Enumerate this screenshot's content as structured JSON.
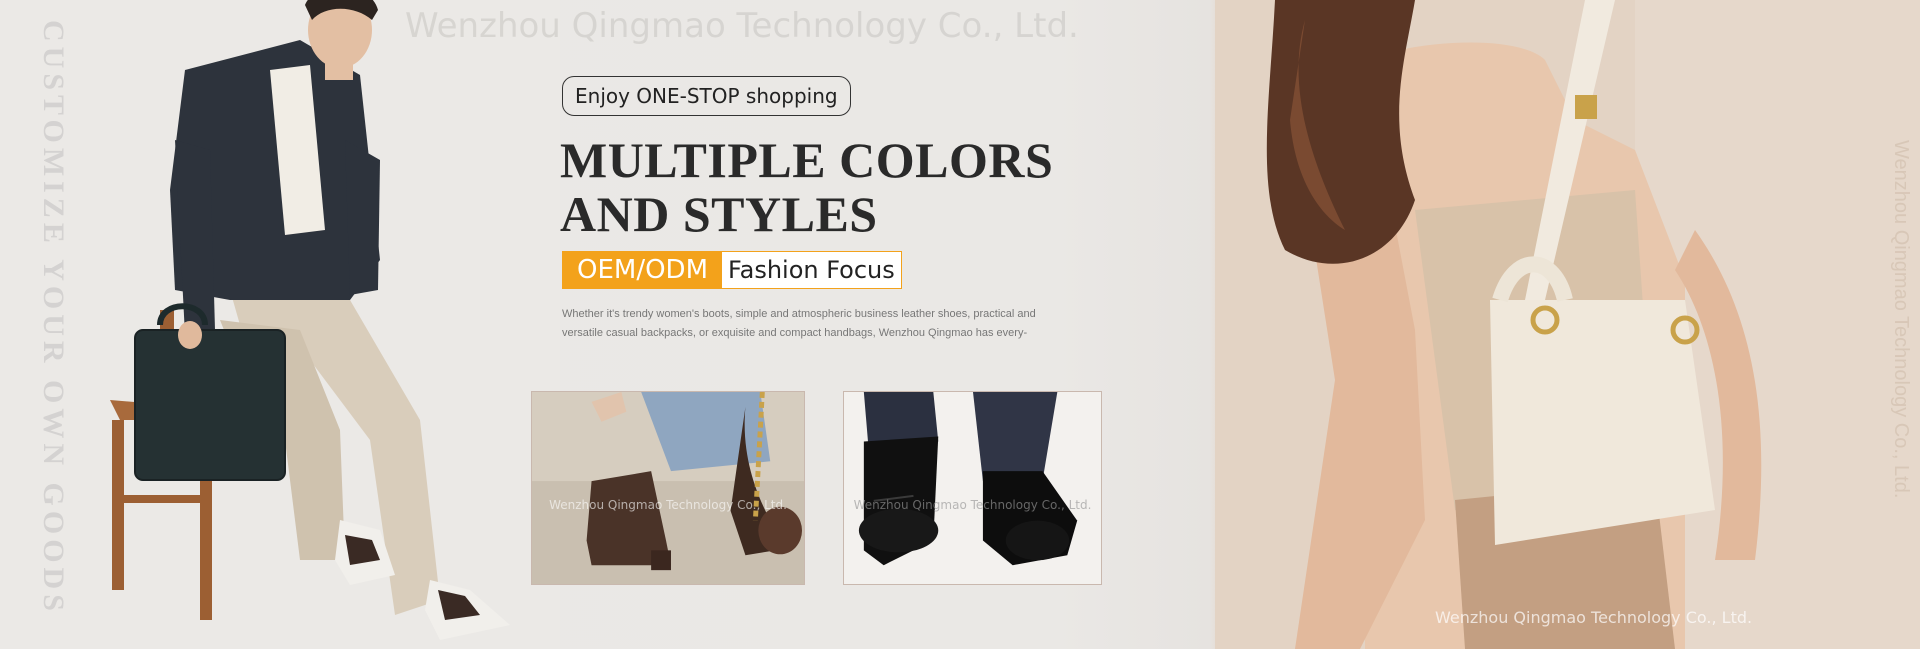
{
  "brand": {
    "watermark_top": "Wenzhou Qingmao Technology Co., Ltd.",
    "watermark_bottom": "Wenzhou Qingmao Technology Co., Ltd.",
    "vertical_left": "CUSTOMIZE YOUR OWN GOODS",
    "vertical_right": "Wenzhou Qingmao Technology Co., Ltd."
  },
  "hero": {
    "pill_label": "Enjoy ONE-STOP shopping",
    "headline_line1": "MULTIPLE COLORS",
    "headline_line2": "AND STYLES",
    "tag_primary": "OEM/ODM",
    "tag_secondary": "Fashion Focus",
    "description": "Whether it's trendy women's boots, simple and atmospheric business leather shoes, practical and versatile casual backpacks, or exquisite and compact handbags, Wenzhou Qingmao has every-"
  },
  "thumbnails": [
    {
      "watermark": "Wenzhou Qingmao Technology Co., Ltd."
    },
    {
      "watermark": "Wenzhou Qingmao Technology Co., Ltd."
    }
  ],
  "colors": {
    "accent": "#f3a21b",
    "background": "#ebe9e6",
    "headline": "#2a2a2a"
  }
}
